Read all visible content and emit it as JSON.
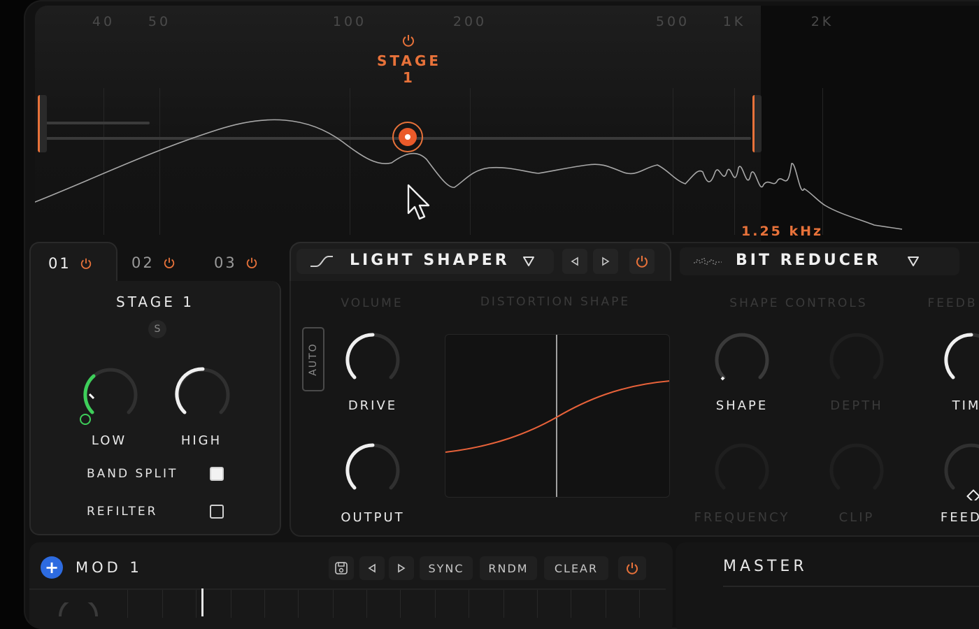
{
  "spectrum": {
    "freq_labels": [
      "40",
      "50",
      "100",
      "200",
      "500",
      "1K",
      "2K"
    ],
    "stage_label": "STAGE 1",
    "crossover_readout": "1.25 kHz"
  },
  "stage_tabs": [
    {
      "label": "01",
      "active": true
    },
    {
      "label": "02",
      "active": false
    },
    {
      "label": "03",
      "active": false
    }
  ],
  "stage_panel": {
    "title": "STAGE 1",
    "solo_label": "S",
    "low_label": "LOW",
    "high_label": "HIGH",
    "band_split_label": "BAND SPLIT",
    "band_split_checked": true,
    "refilter_label": "REFILTER",
    "refilter_checked": false
  },
  "effect1": {
    "name": "LIGHT SHAPER",
    "volume_label": "VOLUME",
    "distortion_label": "DISTORTION SHAPE",
    "auto_label": "AUTO",
    "drive_label": "DRIVE",
    "output_label": "OUTPUT",
    "shape_controls_label": "SHAPE CONTROLS",
    "shape_label": "SHAPE",
    "depth_label": "DEPTH",
    "frequency_label": "FREQUENCY",
    "clip_label": "CLIP",
    "feedback_section_label": "FEEDB",
    "time_label": "TIM",
    "feedback_label": "FEEDB"
  },
  "effect2": {
    "name": "BIT REDUCER"
  },
  "mod": {
    "title": "MOD 1",
    "sync_label": "SYNC",
    "rndm_label": "RNDM",
    "clear_label": "CLEAR"
  },
  "master": {
    "title": "MASTER"
  },
  "colors": {
    "accent": "#e8723a",
    "mod_blue": "#2d6be0",
    "low_knob_green": "#3ecf5a"
  }
}
